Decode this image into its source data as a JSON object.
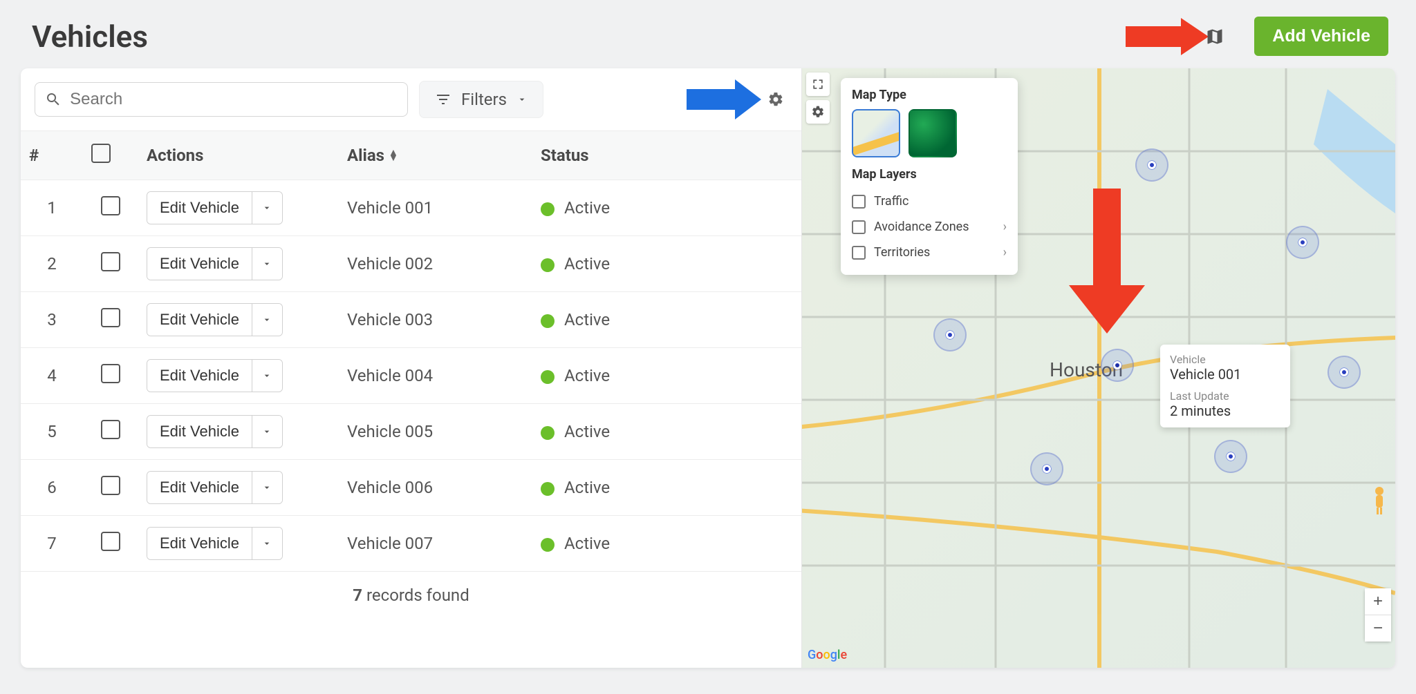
{
  "page": {
    "title": "Vehicles"
  },
  "header": {
    "add_button_label": "Add Vehicle"
  },
  "toolbar": {
    "search_placeholder": "Search",
    "filters_label": "Filters"
  },
  "columns": {
    "num": "#",
    "actions": "Actions",
    "alias": "Alias",
    "status": "Status"
  },
  "action_button_label": "Edit Vehicle",
  "status_active_label": "Active",
  "rows": [
    {
      "num": "1",
      "alias": "Vehicle 001",
      "status": "Active"
    },
    {
      "num": "2",
      "alias": "Vehicle 002",
      "status": "Active"
    },
    {
      "num": "3",
      "alias": "Vehicle 003",
      "status": "Active"
    },
    {
      "num": "4",
      "alias": "Vehicle 004",
      "status": "Active"
    },
    {
      "num": "5",
      "alias": "Vehicle 005",
      "status": "Active"
    },
    {
      "num": "6",
      "alias": "Vehicle 006",
      "status": "Active"
    },
    {
      "num": "7",
      "alias": "Vehicle 007",
      "status": "Active"
    }
  ],
  "footer": {
    "count": "7",
    "label": " records found"
  },
  "map_popup": {
    "map_type_title": "Map Type",
    "map_layers_title": "Map Layers",
    "layers": {
      "traffic": "Traffic",
      "avoidance": "Avoidance Zones",
      "territories": "Territories"
    }
  },
  "tooltip": {
    "vehicle_label": "Vehicle",
    "vehicle_value": "Vehicle 001",
    "update_label": "Last Update",
    "update_value": "2 minutes"
  },
  "map": {
    "city_label": "Houston",
    "attribution": "Google"
  }
}
